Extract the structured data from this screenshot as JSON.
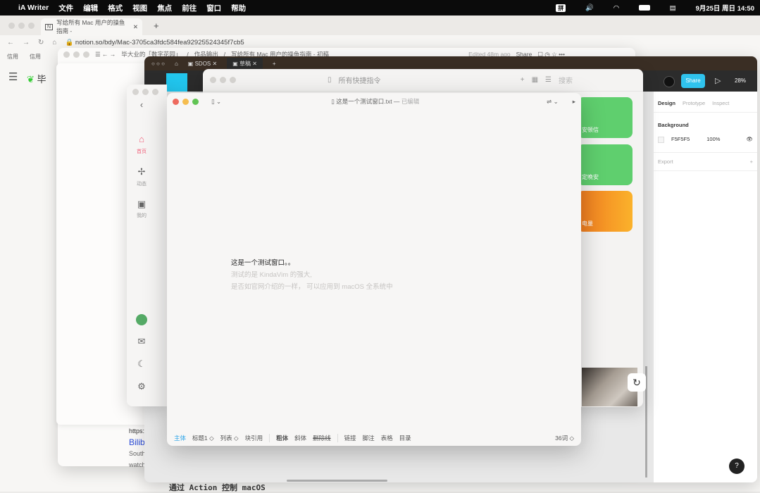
{
  "menubar": {
    "app": "iA Writer",
    "items": [
      "文件",
      "编辑",
      "格式",
      "视图",
      "焦点",
      "前往",
      "窗口",
      "帮助"
    ],
    "ime": "拼",
    "datetime": "9月25日 周日 14:50"
  },
  "browser": {
    "tab_title": "写给所有 Mac 用户的操鱼指南 -",
    "url": "notion.so/bdy/Mac-3705ca3fdc584fea92925524345f7cb5",
    "bookmarks": [
      "信用",
      "信用"
    ],
    "side_title": "毕"
  },
  "notion": {
    "breadcrumb": [
      "毕大业的「数字花园」",
      "作品输出",
      "写给所有 Mac 用户的操鱼指南 - 初稿"
    ],
    "edited": "Edited 48m ago",
    "share": "Share",
    "link_url": "https:/",
    "link_title": "Bilib",
    "link_desc1": "South",
    "link_desc2": "watch"
  },
  "figma": {
    "tabs": [
      "SDOS",
      "草稿"
    ],
    "share": "Share",
    "zoom": "28%",
    "panel_tabs": [
      "Design",
      "Prototype",
      "Inspect"
    ],
    "background_label": "Background",
    "bg_hex": "F5F5F5",
    "bg_opacity": "100%",
    "export_label": "Export"
  },
  "shortcuts": {
    "title": "所有快捷指令",
    "search_placeholder": "搜索",
    "cards": [
      {
        "label": "安顿信",
        "color": "#5fcf6e"
      },
      {
        "label": "定晚安",
        "color": "#5fcf6e"
      },
      {
        "label": "电量",
        "color": "#fbb22b"
      }
    ]
  },
  "bili": {
    "nav": [
      "首页",
      "动态",
      "我的"
    ]
  },
  "writer": {
    "filename": "这是一个测试窗口.txt",
    "status": "已编辑",
    "lines": [
      "这是一个测试窗口。。",
      "测试的是 KindaVim 的强大,",
      "是否如官网介绍的一样， 可以应用到 macOS 全系统中"
    ],
    "toolbar": [
      "主体",
      "标题1 ◇",
      "列表 ◇",
      "块引用",
      "粗体",
      "斜体",
      "删除线",
      "链接",
      "脚注",
      "表格",
      "目录"
    ],
    "word_count": "36词 ◇"
  },
  "bottom_text": "通过 Action 控制 macOS",
  "help": "?"
}
